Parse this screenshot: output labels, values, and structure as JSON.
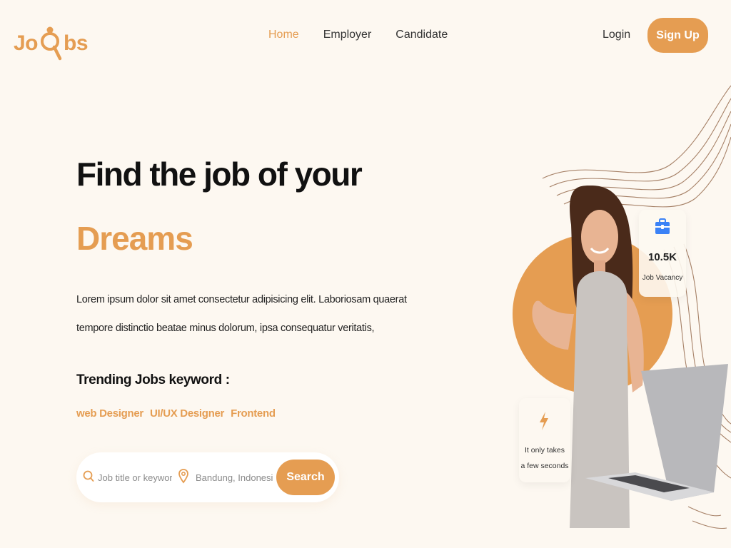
{
  "brand": {
    "logo_left": "Jo",
    "logo_right": "bs",
    "accent_color": "#e59d52",
    "background": "#fdf8f1"
  },
  "nav": {
    "links": [
      {
        "label": "Home",
        "active": true
      },
      {
        "label": "Employer",
        "active": false
      },
      {
        "label": "Candidate",
        "active": false
      }
    ],
    "login": "Login",
    "signup": "Sign Up"
  },
  "hero": {
    "title": "Find the job of your",
    "accent": "Dreams",
    "description": "Lorem ipsum dolor sit amet consectetur adipisicing elit. Laboriosam quaerat tempore distinctio beatae minus dolorum, ipsa consequatur veritatis,"
  },
  "trending": {
    "title": "Trending Jobs keyword :",
    "tags": [
      "web Designer",
      "UI/UX Designer",
      "Frontend"
    ]
  },
  "search": {
    "keyword_placeholder": "Job title or keyword",
    "location_placeholder": "Bandung, Indonesia",
    "button": "Search",
    "icons": [
      "search-icon",
      "location-pin-icon"
    ]
  },
  "stats": {
    "value": "10.5K",
    "label": "Job Vacancy",
    "icon": "briefcase-icon",
    "icon_color": "#3b82f6"
  },
  "speed": {
    "line1": "It only takes",
    "line2": "a few seconds",
    "icon": "lightning-icon"
  }
}
